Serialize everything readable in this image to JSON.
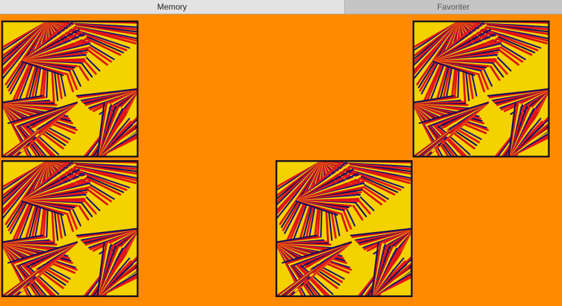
{
  "tabs": [
    {
      "label": "Memory",
      "active": true
    },
    {
      "label": "Favoriter",
      "active": false
    }
  ],
  "board": {
    "background_color": "#ff8a00",
    "cards": [
      {
        "state": "face-up",
        "image": "abstract-line-art"
      },
      {
        "state": "face-up",
        "image": "abstract-line-art"
      },
      {
        "state": "face-up",
        "image": "abstract-line-art"
      },
      {
        "state": "face-up",
        "image": "abstract-line-art"
      }
    ]
  }
}
